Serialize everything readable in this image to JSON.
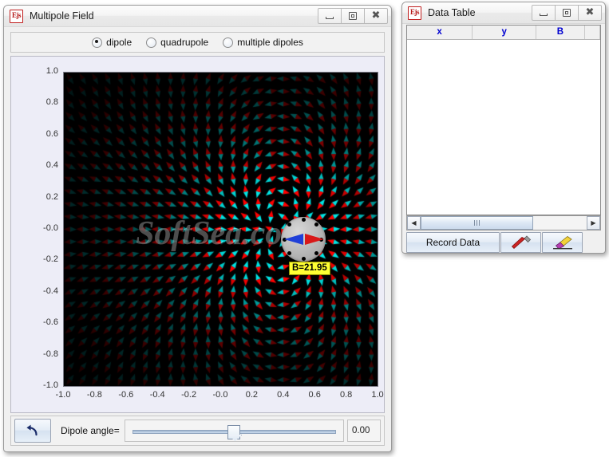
{
  "main_window": {
    "title": "Multipole Field",
    "app_icon": "ejs-icon",
    "app_icon_text": "Ejs",
    "window_controls": {
      "minimize": "minimize-icon",
      "maximize": "maximize-icon",
      "close": "close-icon",
      "close_glyph": "✖"
    },
    "radio_group": {
      "options": [
        {
          "label": "dipole",
          "selected": true
        },
        {
          "label": "quadrupole",
          "selected": false
        },
        {
          "label": "multiple dipoles",
          "selected": false
        }
      ]
    },
    "plot": {
      "y_ticks": [
        "1.0",
        "0.8",
        "0.6",
        "0.4",
        "0.2",
        "-0.0",
        "-0.2",
        "-0.4",
        "-0.6",
        "-0.8",
        "-1.0"
      ],
      "x_ticks": [
        "-1.0",
        "-0.8",
        "-0.6",
        "-0.4",
        "-0.2",
        "-0.0",
        "0.2",
        "0.4",
        "0.6",
        "0.8",
        "1.0"
      ],
      "watermark": "SoftSea.com",
      "readout_tooltip": "B=21.95",
      "background_color": "#000000",
      "arrow_colors": {
        "positive": "#ff0000",
        "negative": "#00e5e5"
      },
      "panel_color": "#ededf7"
    },
    "bottom_bar": {
      "reset_button": "reset-icon",
      "slider_label": "Dipole angle=",
      "slider_value": "0.00",
      "slider_position_pct": 50
    }
  },
  "data_window": {
    "title": "Data Table",
    "app_icon_text": "Ejs",
    "window_controls": {
      "minimize": "minimize-icon",
      "maximize": "maximize-icon",
      "close": "close-icon",
      "close_glyph": "✖"
    },
    "table": {
      "columns": [
        "x",
        "y",
        "B",
        ""
      ],
      "rows": [],
      "header_color": "#0000d0"
    },
    "scrollbar": {
      "left_arrow": "◀",
      "right_arrow": "▶"
    },
    "buttons": [
      {
        "label": "Record Data",
        "icon": null
      },
      {
        "label": "",
        "icon": "wrench-icon"
      },
      {
        "label": "",
        "icon": "broom-icon"
      }
    ]
  },
  "chart_data": {
    "type": "scatter",
    "title": "Multipole Field",
    "xlabel": "",
    "ylabel": "",
    "xlim": [
      -1.0,
      1.0
    ],
    "ylim": [
      -1.0,
      1.0
    ],
    "grid": false,
    "legend": "none",
    "field_type": "dipole",
    "dipole_angle": 0.0,
    "dipole_center": [
      0.38,
      -0.02
    ],
    "probe_reading": {
      "label": "B",
      "value": 21.95
    },
    "vector_grid": {
      "nx": 25,
      "ny": 25,
      "glyph": "double-arrow"
    }
  }
}
